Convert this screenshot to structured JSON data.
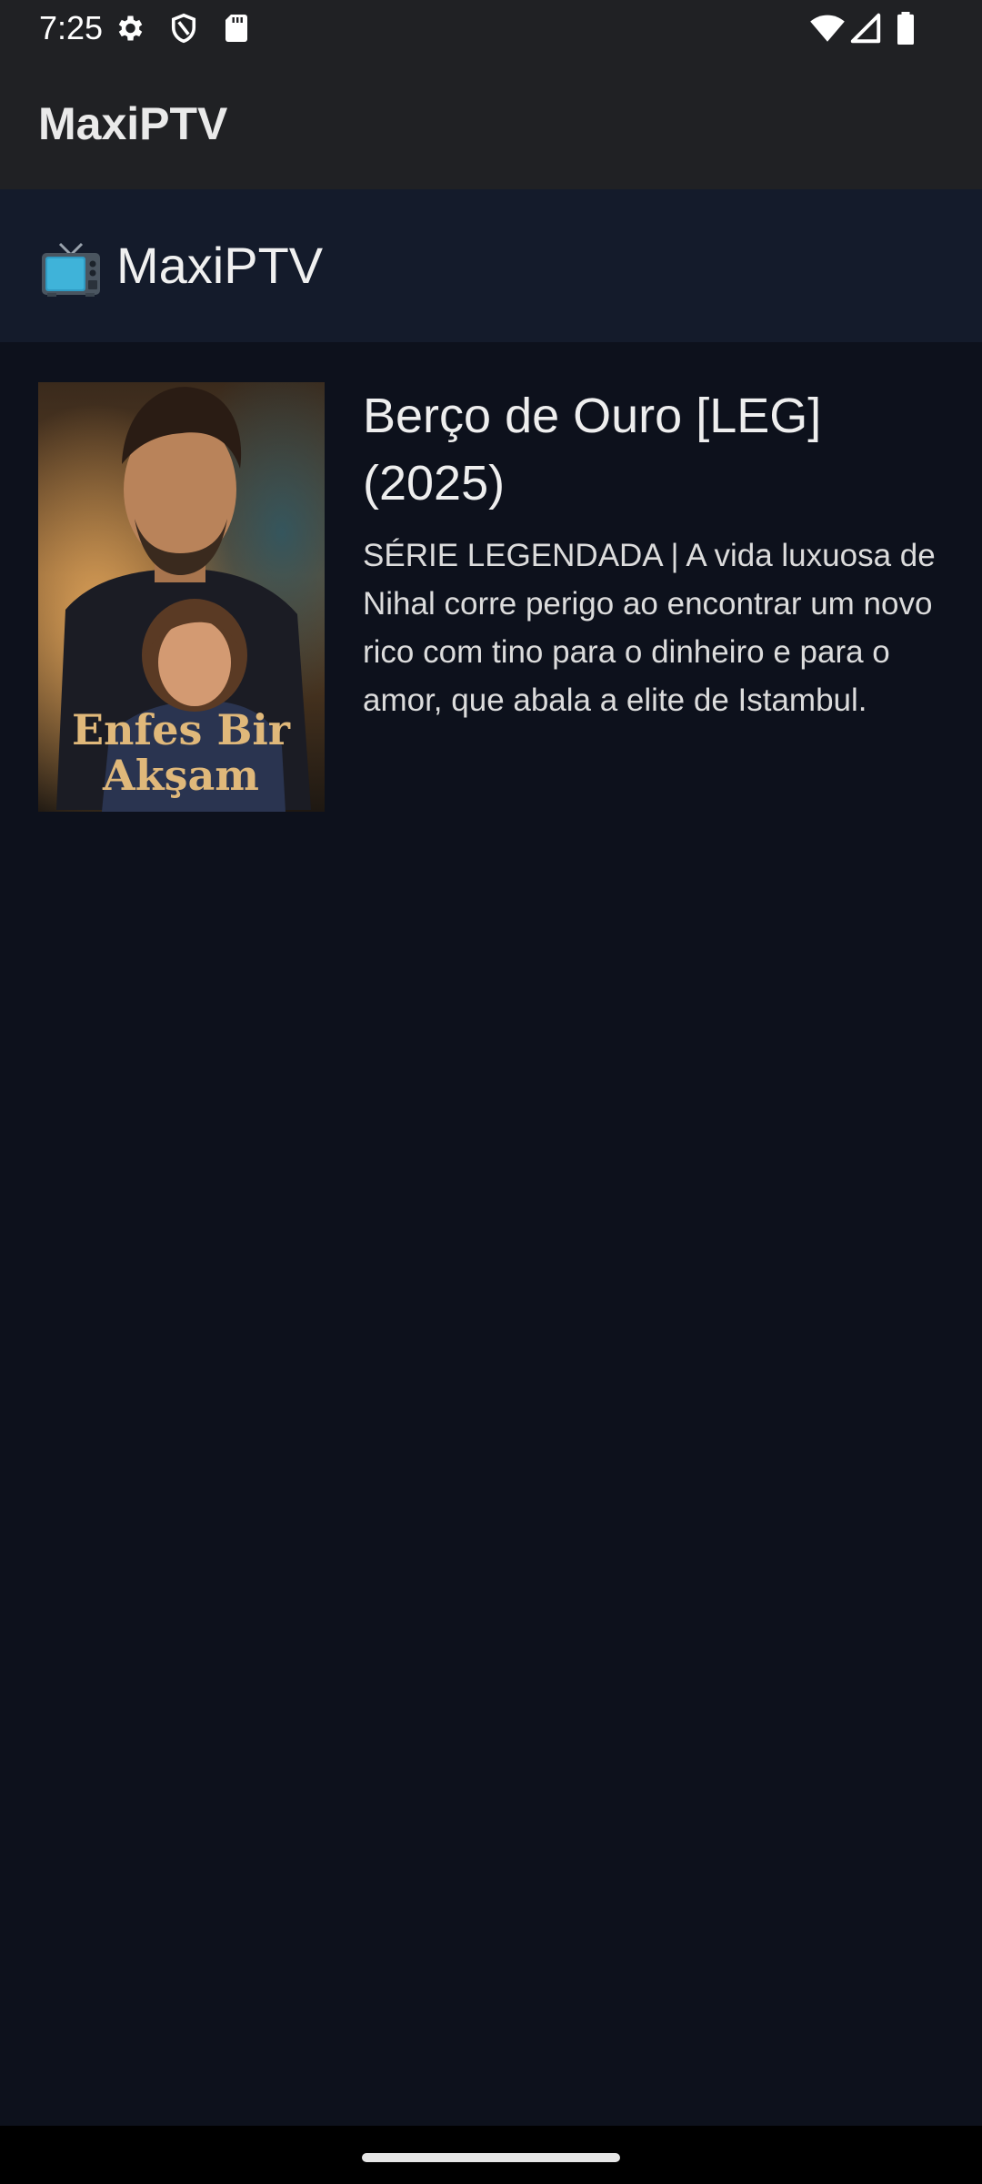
{
  "status_bar": {
    "time": "7:25",
    "left_icons": [
      "gear-icon",
      "shield-icon",
      "sd-card-icon"
    ],
    "right_icons": [
      "wifi-icon",
      "signal-icon",
      "battery-icon"
    ]
  },
  "app_bar": {
    "title": "MaxiPTV"
  },
  "header": {
    "icon": "tv-icon",
    "title": "MaxiPTV"
  },
  "series": [
    {
      "title": "Berço de Ouro [LEG] (2025)",
      "description": "SÉRIE LEGENDADA | A vida luxuosa de Nihal corre perigo ao encontrar um novo rico com tino para o dinheiro e para o amor, que abala a elite de Istambul.",
      "poster_text": "Enfes Bir Akşam"
    }
  ],
  "colors": {
    "status_bar_bg": "#202124",
    "header_bg": "#141b2b",
    "content_bg": "#0d111c",
    "poster_text": "#e0b87a"
  }
}
